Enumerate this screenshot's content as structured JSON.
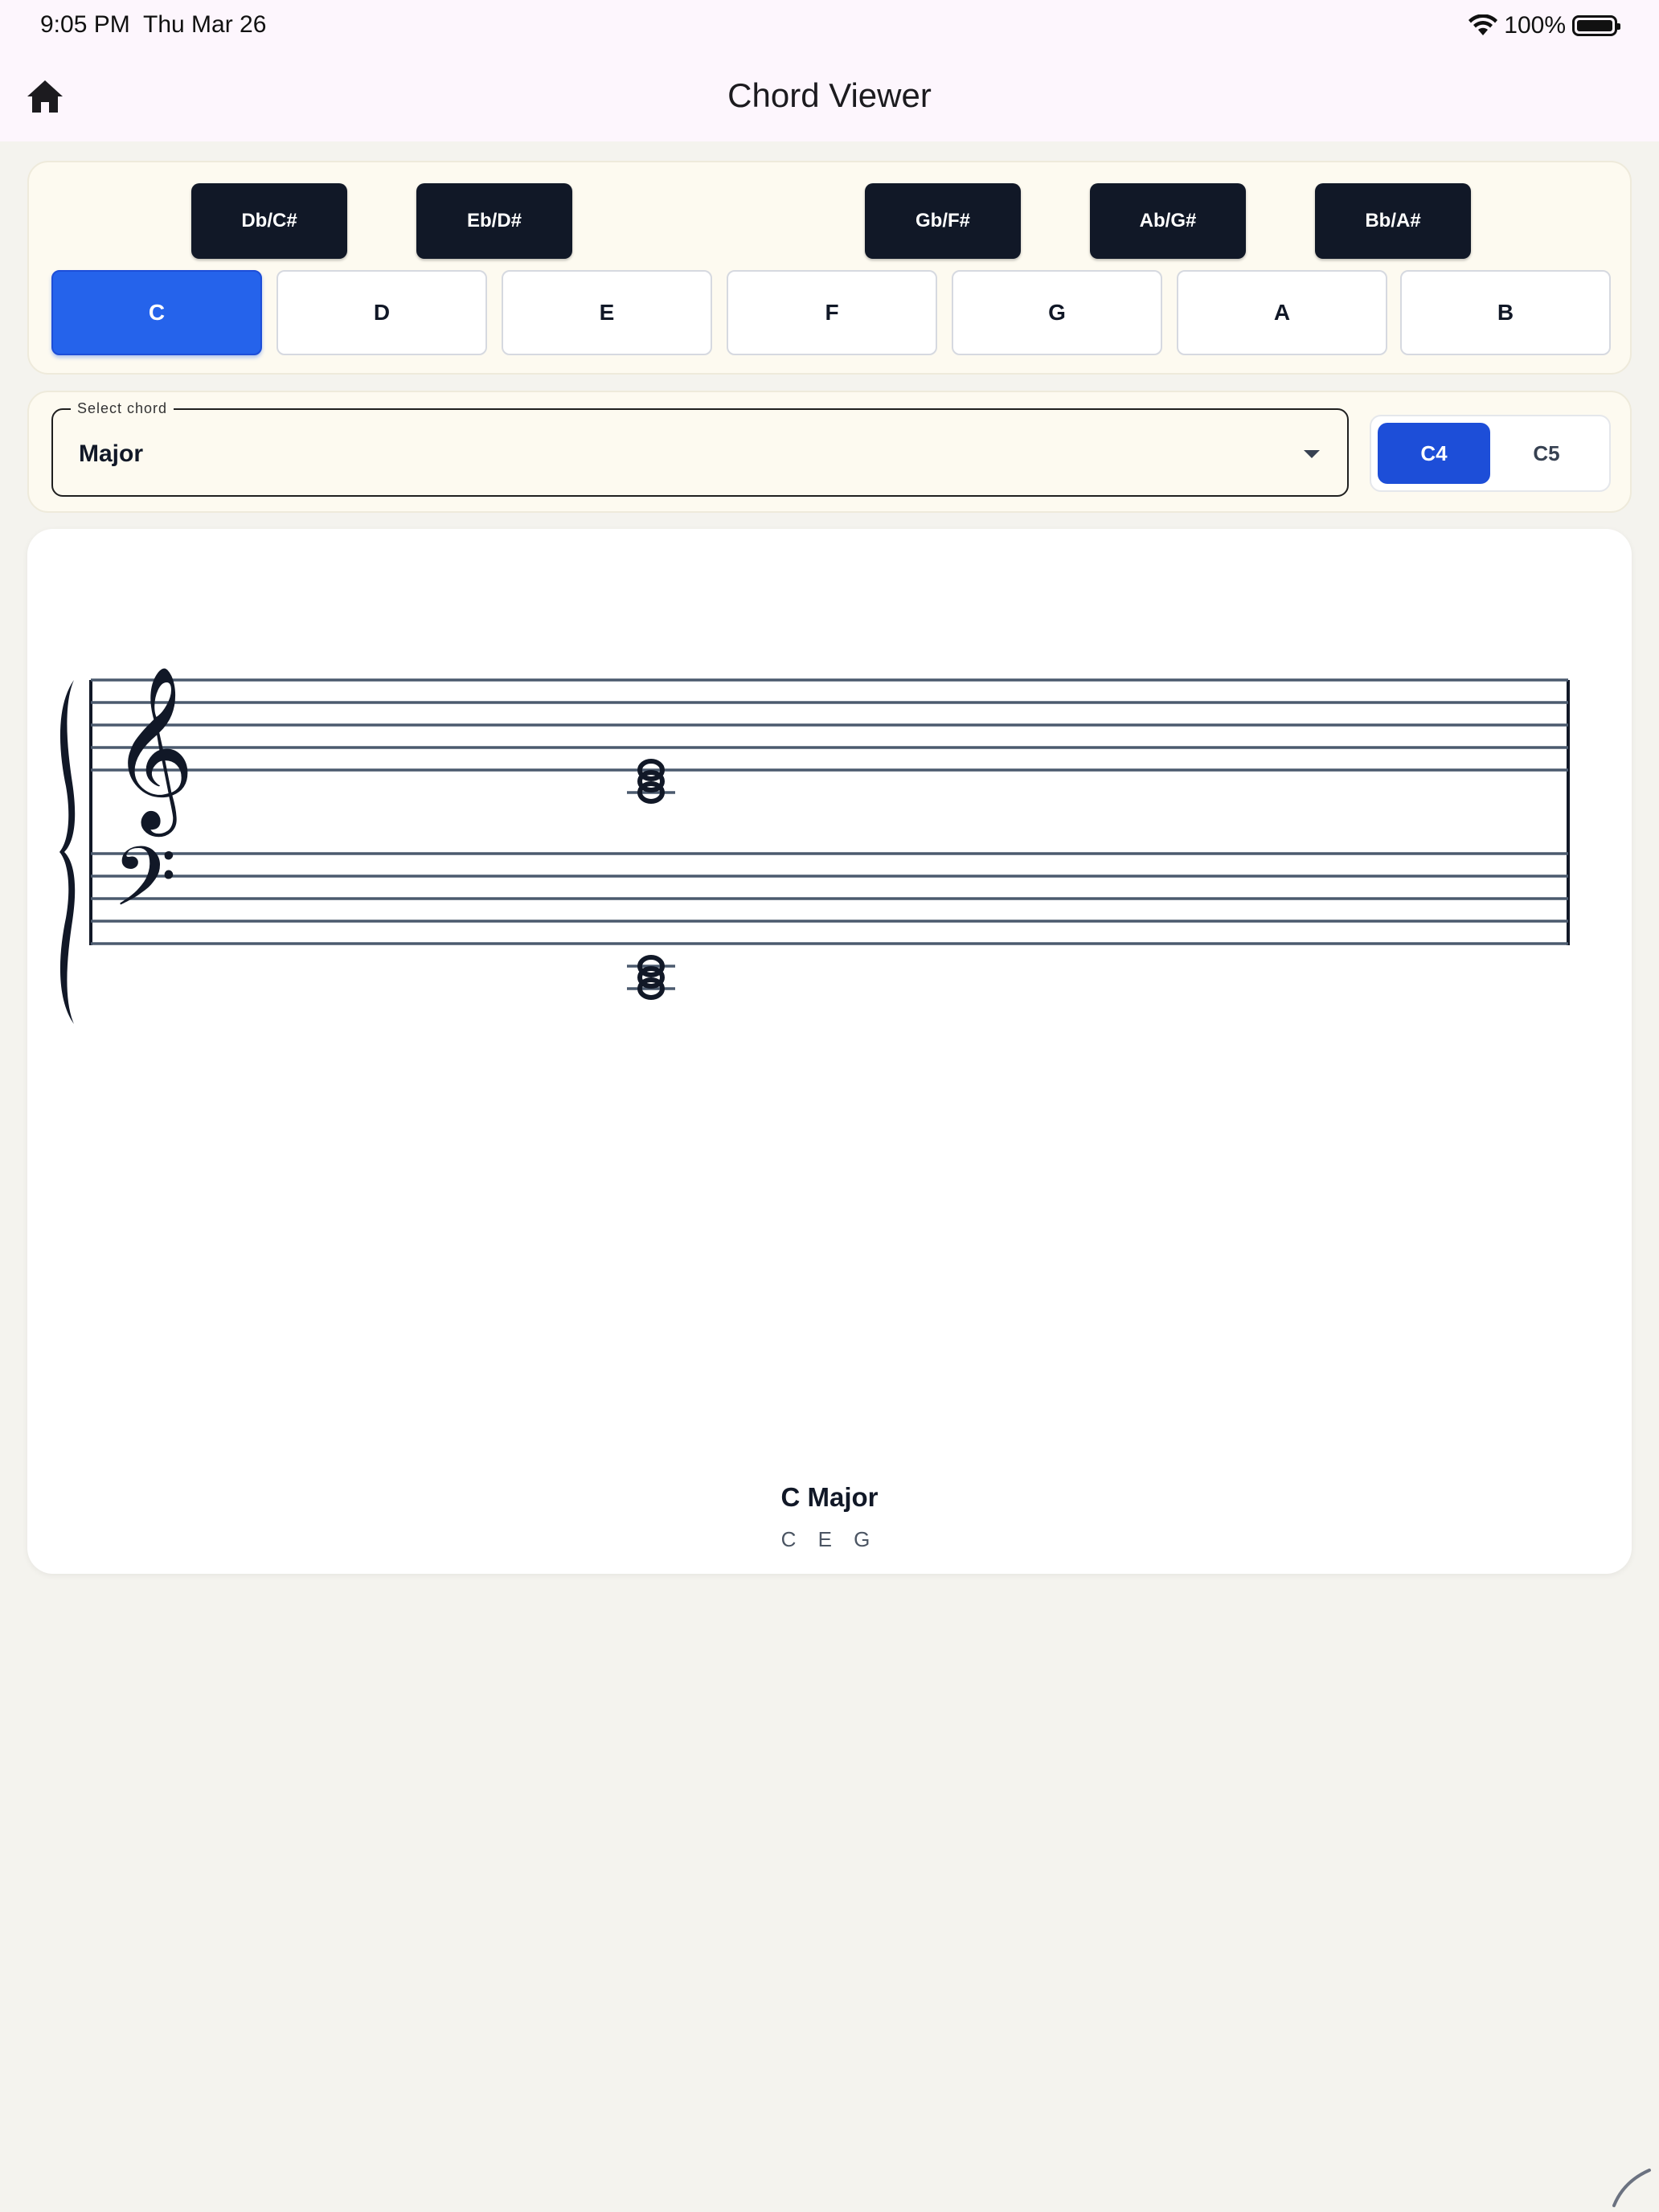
{
  "status_bar": {
    "time": "9:05 PM",
    "date": "Thu Mar 26",
    "battery": "100%",
    "wifi_icon": "wifi-icon",
    "battery_icon": "battery-icon"
  },
  "header": {
    "title": "Chord Viewer",
    "home_icon": "home-icon"
  },
  "keyboard": {
    "black_keys": [
      "Db/C#",
      "Eb/D#",
      "Gb/F#",
      "Ab/G#",
      "Bb/A#"
    ],
    "white_keys": [
      "C",
      "D",
      "E",
      "F",
      "G",
      "A",
      "B"
    ],
    "selected": "C"
  },
  "chord_select": {
    "label": "Select chord",
    "value": "Major"
  },
  "octave": {
    "options": [
      "C4",
      "C5"
    ],
    "selected": "C4"
  },
  "result": {
    "chord_name": "C Major",
    "notes": "C E G"
  },
  "colors": {
    "accent": "#2563eb",
    "octave_active": "#1d4ed8",
    "black_key": "#111827",
    "card_bg": "#fdfaf0",
    "page_bg": "#f4f3ee",
    "header_bg": "#fdf6fd"
  }
}
